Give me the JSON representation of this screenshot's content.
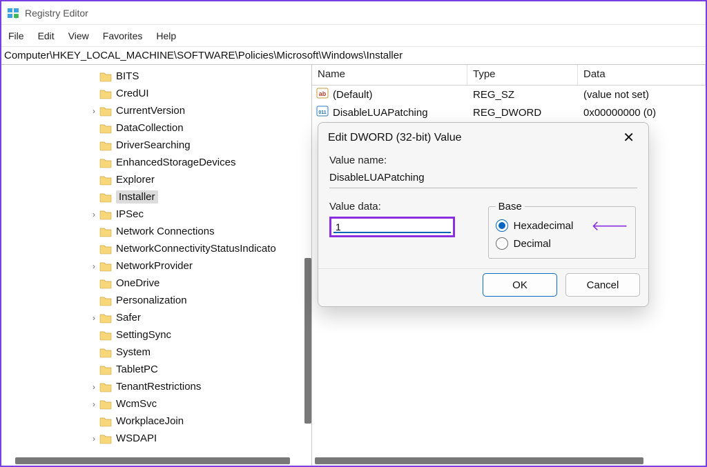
{
  "window": {
    "title": "Registry Editor"
  },
  "menu": {
    "file": "File",
    "edit": "Edit",
    "view": "View",
    "favorites": "Favorites",
    "help": "Help"
  },
  "path": "Computer\\HKEY_LOCAL_MACHINE\\SOFTWARE\\Policies\\Microsoft\\Windows\\Installer",
  "tree": [
    {
      "label": "BITS",
      "expander": "",
      "indent": 7
    },
    {
      "label": "CredUI",
      "expander": "",
      "indent": 7
    },
    {
      "label": "CurrentVersion",
      "expander": ">",
      "indent": 7
    },
    {
      "label": "DataCollection",
      "expander": "",
      "indent": 7
    },
    {
      "label": "DriverSearching",
      "expander": "",
      "indent": 7
    },
    {
      "label": "EnhancedStorageDevices",
      "expander": "",
      "indent": 7
    },
    {
      "label": "Explorer",
      "expander": "",
      "indent": 7
    },
    {
      "label": "Installer",
      "expander": "",
      "indent": 7,
      "selected": true
    },
    {
      "label": "IPSec",
      "expander": ">",
      "indent": 7
    },
    {
      "label": "Network Connections",
      "expander": "",
      "indent": 7
    },
    {
      "label": "NetworkConnectivityStatusIndicato",
      "expander": "",
      "indent": 7
    },
    {
      "label": "NetworkProvider",
      "expander": ">",
      "indent": 7
    },
    {
      "label": "OneDrive",
      "expander": "",
      "indent": 7
    },
    {
      "label": "Personalization",
      "expander": "",
      "indent": 7
    },
    {
      "label": "Safer",
      "expander": ">",
      "indent": 7
    },
    {
      "label": "SettingSync",
      "expander": "",
      "indent": 7
    },
    {
      "label": "System",
      "expander": "",
      "indent": 7
    },
    {
      "label": "TabletPC",
      "expander": "",
      "indent": 7
    },
    {
      "label": "TenantRestrictions",
      "expander": ">",
      "indent": 7
    },
    {
      "label": "WcmSvc",
      "expander": ">",
      "indent": 7
    },
    {
      "label": "WorkplaceJoin",
      "expander": "",
      "indent": 7
    },
    {
      "label": "WSDAPI",
      "expander": ">",
      "indent": 7
    }
  ],
  "list": {
    "headers": {
      "name": "Name",
      "type": "Type",
      "data": "Data"
    },
    "rows": [
      {
        "icon": "string",
        "name": "(Default)",
        "type": "REG_SZ",
        "data": "(value not set)"
      },
      {
        "icon": "binary",
        "name": "DisableLUAPatching",
        "type": "REG_DWORD",
        "data": "0x00000000 (0)"
      }
    ]
  },
  "dialog": {
    "title": "Edit DWORD (32-bit) Value",
    "labels": {
      "valueName": "Value name:",
      "valueData": "Value data:",
      "baseLegend": "Base",
      "hex": "Hexadecimal",
      "dec": "Decimal"
    },
    "valueName": "DisableLUAPatching",
    "valueData": "1",
    "baseSelected": "hex",
    "buttons": {
      "ok": "OK",
      "cancel": "Cancel"
    }
  },
  "glyphs": {
    "arrow": "🡐",
    "close": "✕",
    "chevron": "›"
  }
}
